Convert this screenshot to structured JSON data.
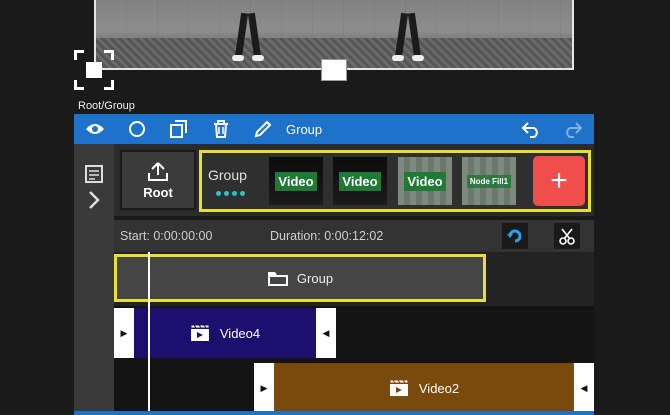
{
  "path_label": "Root/Group",
  "toolbar": {
    "items": [
      {
        "icon": "eye-icon"
      },
      {
        "icon": "circle-icon"
      },
      {
        "icon": "copy-icon"
      },
      {
        "icon": "trash-icon"
      },
      {
        "icon": "pen-icon"
      }
    ],
    "title": "Group",
    "undo_icon": "undo-icon",
    "redo_icon": "redo-icon"
  },
  "nodes": {
    "root_label": "Root",
    "group_label": "Group",
    "thumbs": [
      {
        "label": "Video"
      },
      {
        "label": "Video"
      },
      {
        "label": "Video"
      },
      {
        "label": "Node Fill1"
      }
    ],
    "add_label": "+"
  },
  "info": {
    "start": "Start:  0:00:00:00",
    "duration": "Duration:  0:00:12:02"
  },
  "timeline": {
    "group_label": "Group",
    "clips": [
      {
        "label": "Video4",
        "color": "#1d0f6e"
      },
      {
        "label": "Video2",
        "color": "#7a4a0d"
      }
    ]
  },
  "colors": {
    "accent": "#1f72c9",
    "selection": "#e9dd38",
    "add": "#f04d4d"
  }
}
